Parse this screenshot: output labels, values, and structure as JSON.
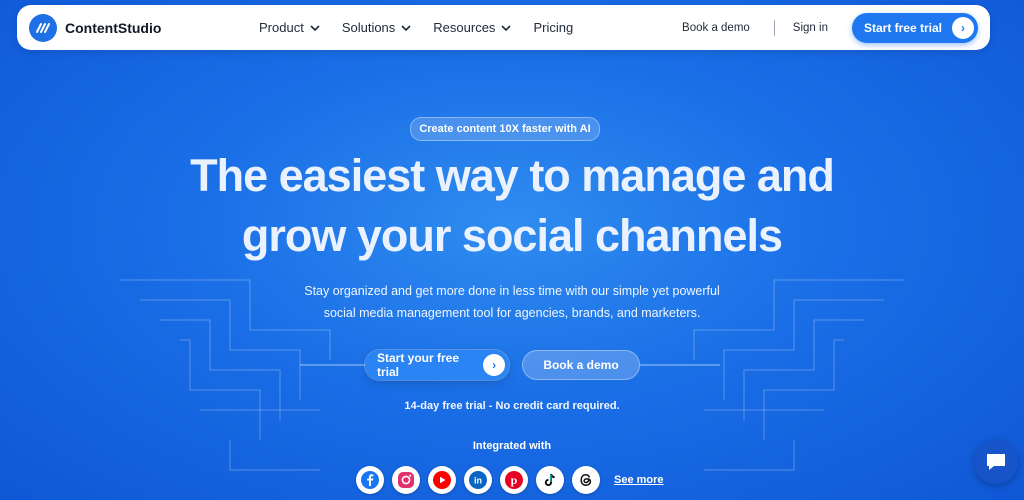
{
  "nav": {
    "brand": "ContentStudio",
    "menu": [
      {
        "label": "Product",
        "has_dropdown": true
      },
      {
        "label": "Solutions",
        "has_dropdown": true
      },
      {
        "label": "Resources",
        "has_dropdown": true
      },
      {
        "label": "Pricing",
        "has_dropdown": false
      }
    ],
    "book_demo": "Book a demo",
    "sign_in": "Sign in",
    "cta": "Start free trial"
  },
  "hero": {
    "badge": "Create content 10X faster with AI",
    "headline_line1": "The easiest way to manage and",
    "headline_line2": "grow your social channels",
    "sub_line1": "Stay organized and get more done in less time with our simple yet powerful",
    "sub_line2": "social media management tool for agencies, brands, and marketers.",
    "primary_button": "Start your free trial",
    "secondary_button": "Book a demo",
    "trial_note": "14-day free trial - No credit card required."
  },
  "integrations": {
    "heading": "Integrated with",
    "icons": [
      "facebook-icon",
      "instagram-icon",
      "youtube-icon",
      "linkedin-icon",
      "pinterest-icon",
      "tiktok-icon",
      "threads-icon"
    ],
    "see_more": "See more"
  },
  "colors": {
    "accent": "#1f78f0",
    "background": "#1a6ee6",
    "facebook": "#1877f2",
    "instagram": "#e1306c",
    "youtube": "#ff0000",
    "linkedin": "#0a66c2",
    "pinterest": "#e60023"
  }
}
